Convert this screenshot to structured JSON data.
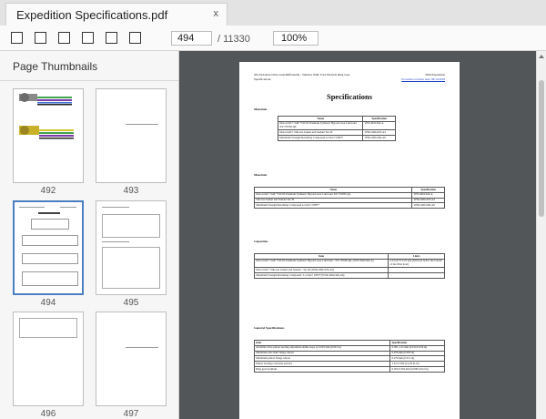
{
  "tab": {
    "title": "Expedition Specifications.pdf",
    "close_label": "x"
  },
  "toolbar": {
    "page_current": "494",
    "page_total": "/ 11330",
    "zoom": "100%"
  },
  "sidebar": {
    "title": "Page Thumbnails",
    "thumbnails": [
      {
        "page": "492",
        "selected": false
      },
      {
        "page": "493",
        "selected": false
      },
      {
        "page": "494",
        "selected": true
      },
      {
        "page": "495",
        "selected": false
      },
      {
        "page": "496",
        "selected": false
      },
      {
        "page": "497",
        "selected": false
      }
    ]
  },
  "colors": {
    "selected_border": "#4a7fc1",
    "viewer_bg": "#525659",
    "link": "#1a3cc9"
  },
  "document": {
    "header_left_1": "205-02A Rear Drive Axle/Differential - Vehicles With: Ford 8.8-Inch Ring Gear",
    "header_left_2": "Specifications",
    "header_right_1": "2020 Expedition",
    "header_right_2": "Procedure revision date: 08/14/2018",
    "title": "Specifications",
    "sections": [
      {
        "title": "Materials",
        "headers": [
          "Name",
          "Specification"
        ],
        "rows": [
          [
            "Motorcraft® SAE 75W-85 Premium Synthetic Hypoid Gear Lubricant XY-75W85-QL",
            "WSS-M2C942-A"
          ],
          [
            "Motorcraft® Silicone Gasket and Sealant TA-30",
            "WSK-M4G323-A4"
          ],
          [
            "Maximum Strength Retaining Compound Loctite® 638™",
            "WSK-M2G349-A6"
          ]
        ]
      },
      {
        "title": "Materials",
        "headers": [
          "Name",
          "Specification"
        ],
        "rows": [
          [
            "Motorcraft® SAE 75W-85 Premium Synthetic Hypoid Gear Lubricant XY-75W85-QL",
            "WSS-M2C942-A"
          ],
          [
            "Silicone Gasket and Sealant TA-30",
            "WSK-M4G323-A4"
          ],
          [
            "Maximum Strength Retaining Compound Loctite® 638™",
            "WSK-M2G349-A6"
          ]
        ]
      },
      {
        "title": "Capacities",
        "headers": [
          "Item",
          "Liters"
        ],
        "rows": [
          [
            "Motorcraft® SAE 75W-85 Premium Synthetic Hypoid Gear Lubricant / XY-75W85-QL (WSS-M2C942-A)",
            "2.41 (4.73-5.25 pts) (fill level below the bottom of the filler hole)"
          ],
          [
            "Motorcraft® Silicone Gasket and Sealant / TA-30 (WSK-M4G323-A4)",
            "-"
          ],
          [
            "Maximum Strength Retaining Compound / Loctite® 638™ (WSK-M2G349-A6)",
            "-"
          ]
        ]
      },
      {
        "title": "General Specifications",
        "headers": [
          "Item",
          "Specification"
        ],
        "rows": [
          [
            "Available drive pinion bearing adjustment shims steps of 0.025 mm (0.001 in)",
            "0.381-1.25 mm (0.010-0.050 in)"
          ],
          [
            "Maximum axle shaft flange runout",
            "0.076 mm (0.003 in)"
          ],
          [
            "Maximum pinion flange runout",
            "0.279 mm (0.011 in)"
          ],
          [
            "Pinion bearing rotational preload",
            "1.6-3.3 Nm (14-29 lb-in)"
          ],
          [
            "Ring gear backlash",
            "0.203-0.304 mm (0.008-0.012 in)"
          ]
        ]
      }
    ]
  }
}
